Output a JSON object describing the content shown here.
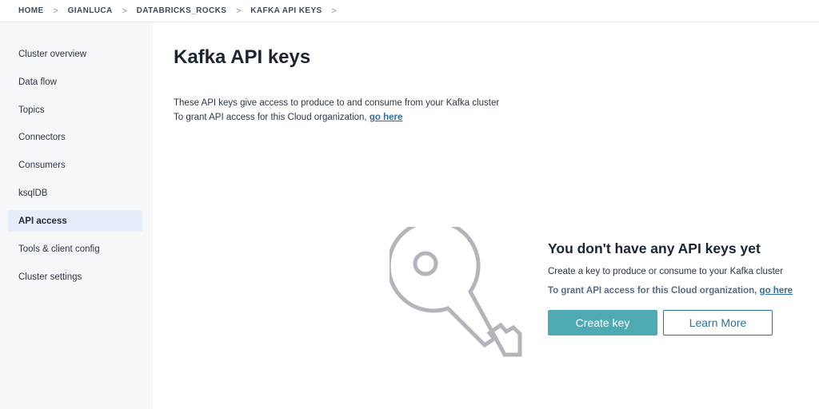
{
  "breadcrumb": {
    "items": [
      "HOME",
      "GIANLUCA",
      "DATABRICKS_ROCKS",
      "KAFKA API KEYS"
    ],
    "separator": ">"
  },
  "sidebar": {
    "items": [
      {
        "label": "Cluster overview",
        "active": false
      },
      {
        "label": "Data flow",
        "active": false
      },
      {
        "label": "Topics",
        "active": false
      },
      {
        "label": "Connectors",
        "active": false
      },
      {
        "label": "Consumers",
        "active": false
      },
      {
        "label": "ksqlDB",
        "active": false
      },
      {
        "label": "API access",
        "active": true
      },
      {
        "label": "Tools & client config",
        "active": false
      },
      {
        "label": "Cluster settings",
        "active": false
      }
    ]
  },
  "main": {
    "title": "Kafka API keys",
    "intro_line1": "These API keys give access to produce to and consume from your Kafka cluster",
    "intro_line2": "To grant API access for this Cloud organization,",
    "intro_link": "go here",
    "illustration_icon": "key-icon",
    "empty_state": {
      "title": "You don't have any API keys yet",
      "description": "Create a key to produce or consume to your Kafka cluster",
      "grant_text": "To grant API access for this Cloud organization,",
      "grant_link": "go here",
      "create_button": "Create key",
      "learn_more_button": "Learn More"
    }
  },
  "colors": {
    "accent": "#4eaab3",
    "link": "#2f6f9f",
    "sidebar_bg": "#f6f7f8",
    "active_item_bg": "#e6eef9",
    "illustration_stroke": "#b3b5bb"
  }
}
